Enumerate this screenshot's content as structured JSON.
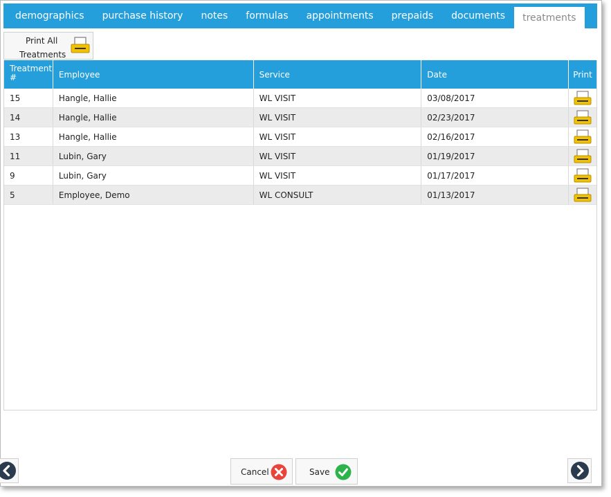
{
  "tabs": [
    {
      "label": "demographics"
    },
    {
      "label": "purchase history"
    },
    {
      "label": "notes"
    },
    {
      "label": "formulas"
    },
    {
      "label": "appointments"
    },
    {
      "label": "prepaids"
    },
    {
      "label": "documents"
    },
    {
      "label": "treatments"
    }
  ],
  "active_tab": "treatments",
  "print_all": {
    "line1": "Print All",
    "line2": "Treatments",
    "icon": "printer-icon"
  },
  "table": {
    "headers": {
      "treatment": "Treatment #",
      "employee": "Employee",
      "service": "Service",
      "date": "Date",
      "print": "Print"
    },
    "rows": [
      {
        "treatment": "15",
        "employee": "Hangle, Hallie",
        "service": "WL VISIT",
        "date": "03/08/2017"
      },
      {
        "treatment": "14",
        "employee": "Hangle, Hallie",
        "service": "WL VISIT",
        "date": "02/23/2017"
      },
      {
        "treatment": "13",
        "employee": "Hangle, Hallie",
        "service": "WL VISIT",
        "date": "02/16/2017"
      },
      {
        "treatment": "11",
        "employee": "Lubin, Gary",
        "service": "WL VISIT",
        "date": "01/19/2017"
      },
      {
        "treatment": "9",
        "employee": "Lubin, Gary",
        "service": "WL VISIT",
        "date": "01/17/2017"
      },
      {
        "treatment": "5",
        "employee": "Employee, Demo",
        "service": "WL CONSULT",
        "date": "01/13/2017"
      }
    ]
  },
  "footer": {
    "cancel_label": "Cancel",
    "save_label": "Save"
  },
  "colors": {
    "accent": "#259fdb",
    "cancel": "#e8453c",
    "save": "#2cb34a",
    "printer": "#f2c200",
    "nav": "#2a3b4d"
  }
}
